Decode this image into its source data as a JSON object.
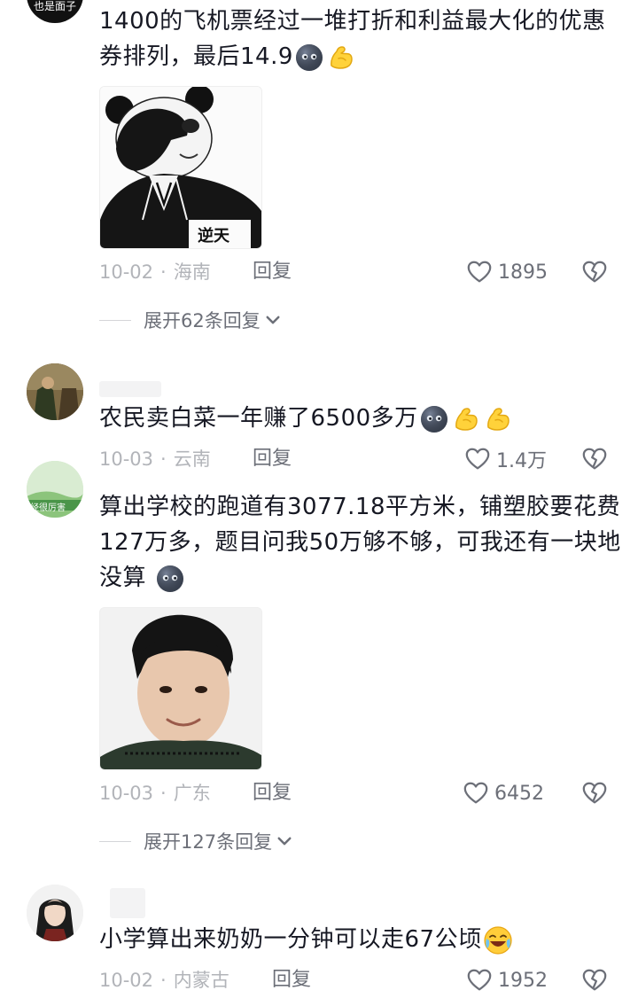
{
  "comments": [
    {
      "avatar_text": "也是面子",
      "text": "1400的飞机票经过一堆打折和利益最大化的优惠券排列，最后14.9",
      "date": "10-02",
      "location": "海南",
      "reply_label": "回复",
      "likes": "1895",
      "image_caption": "逆天",
      "expand_label": "展开62条回复"
    },
    {
      "text": "农民卖白菜一年赚了6500多万",
      "date": "10-03",
      "location": "云南",
      "reply_label": "回复",
      "likes": "1.4万"
    },
    {
      "avatar_text": "经很厉害",
      "text": "算出学校的跑道有3077.18平方米，铺塑胶要花费127万多，题目问我50万够不够，可我还有一块地没算",
      "date": "10-03",
      "location": "广东",
      "reply_label": "回复",
      "likes": "6452",
      "expand_label": "展开127条回复"
    },
    {
      "text": "小学算出来奶奶一分钟可以走67公顷",
      "date": "10-02",
      "location": "内蒙古",
      "reply_label": "回复",
      "likes": "1952"
    }
  ],
  "icons": {
    "like": "heart-outline-icon",
    "dislike": "broken-heart-icon",
    "expand": "chevron-down-icon"
  },
  "colors": {
    "text": "#161823",
    "meta": "#b2b4b9",
    "action": "#6c6f78"
  }
}
